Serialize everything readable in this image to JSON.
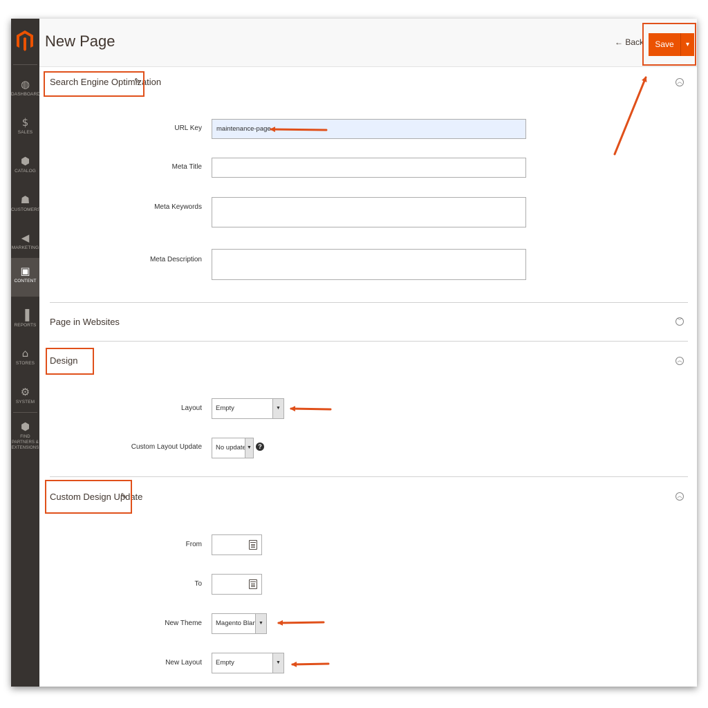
{
  "sidebar": {
    "items": [
      {
        "icon": "dashboard-icon",
        "glyph": "◍",
        "label": "DASHBOARD"
      },
      {
        "icon": "dollar-icon",
        "glyph": "$",
        "label": "SALES"
      },
      {
        "icon": "cube-icon",
        "glyph": "⬢",
        "label": "CATALOG"
      },
      {
        "icon": "person-icon",
        "glyph": "☗",
        "label": "CUSTOMERS"
      },
      {
        "icon": "megaphone-icon",
        "glyph": "◀",
        "label": "MARKETING"
      },
      {
        "icon": "content-icon",
        "glyph": "▣",
        "label": "CONTENT"
      },
      {
        "icon": "bar-chart-icon",
        "glyph": "▐",
        "label": "REPORTS"
      },
      {
        "icon": "store-icon",
        "glyph": "⌂",
        "label": "STORES"
      },
      {
        "icon": "gear-icon",
        "glyph": "⚙",
        "label": "SYSTEM"
      },
      {
        "icon": "extensions-icon",
        "glyph": "⬢",
        "label": "FIND PARTNERS & EXTENSIONS"
      }
    ]
  },
  "header": {
    "title": "New Page",
    "back_label": "← Back",
    "save_label": "Save",
    "save_split": "▾"
  },
  "sections": {
    "seo": {
      "title": "Search Engine Optimization",
      "url_key_label": "URL Key",
      "url_key_value": "maintenance-page",
      "meta_title_label": "Meta Title",
      "meta_keywords_label": "Meta Keywords",
      "meta_description_label": "Meta Description"
    },
    "websites": {
      "title": "Page in Websites"
    },
    "design": {
      "title": "Design",
      "layout_label": "Layout",
      "layout_value": "Empty",
      "custom_layout_label": "Custom Layout Update",
      "custom_layout_value": "No update"
    },
    "custom_design": {
      "title": "Custom Design Update",
      "from_label": "From",
      "to_label": "To",
      "new_theme_label": "New Theme",
      "new_theme_value": "Magento Blank",
      "new_layout_label": "New Layout",
      "new_layout_value": "Empty"
    }
  },
  "colors": {
    "accent": "#eb5202",
    "annotation": "#e0501a",
    "sidebar": "#373330"
  }
}
